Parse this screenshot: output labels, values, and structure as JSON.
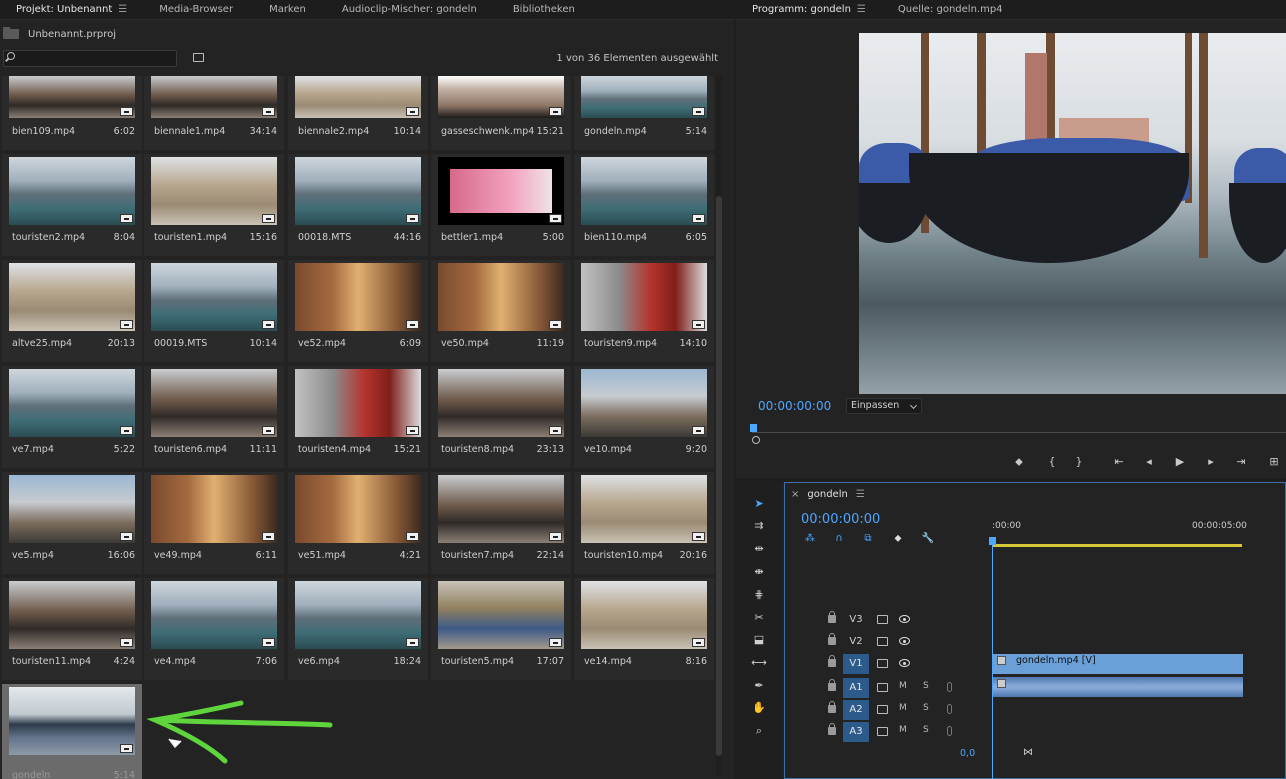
{
  "project_panel": {
    "tabs": [
      {
        "label": "Projekt: Unbenannt",
        "active": true
      },
      {
        "label": "Media-Browser",
        "active": false
      },
      {
        "label": "Marken",
        "active": false
      },
      {
        "label": "Audioclip-Mischer: gondeln",
        "active": false
      },
      {
        "label": "Bibliotheken",
        "active": false
      }
    ],
    "project_file": "Unbenannt.prproj",
    "search_placeholder": "",
    "selection_status": "1 von 36 Elementen ausgewählt",
    "items": [
      {
        "name": "bien109.mp4",
        "duration": "6:02",
        "style": "crowd"
      },
      {
        "name": "biennale1.mp4",
        "duration": "34:14",
        "style": "crowd"
      },
      {
        "name": "biennale2.mp4",
        "duration": "10:14",
        "style": "square"
      },
      {
        "name": "gasseschwenk.mp4",
        "duration": "15:21",
        "style": "wall"
      },
      {
        "name": "gondeln.mp4",
        "duration": "5:14",
        "style": "canal"
      },
      {
        "name": "touristen2.mp4",
        "duration": "8:04",
        "style": "canal"
      },
      {
        "name": "touristen1.mp4",
        "duration": "15:16",
        "style": "square"
      },
      {
        "name": "00018.MTS",
        "duration": "44:16",
        "style": "canal"
      },
      {
        "name": "bettler1.mp4",
        "duration": "5:00",
        "style": "pink"
      },
      {
        "name": "bien110.mp4",
        "duration": "6:05",
        "style": "canal"
      },
      {
        "name": "altve25.mp4",
        "duration": "20:13",
        "style": "square"
      },
      {
        "name": "00019.MTS",
        "duration": "10:14",
        "style": "canal"
      },
      {
        "name": "ve52.mp4",
        "duration": "6:09",
        "style": "street"
      },
      {
        "name": "ve50.mp4",
        "duration": "11:19",
        "style": "street"
      },
      {
        "name": "touristen9.mp4",
        "duration": "14:10",
        "style": "red"
      },
      {
        "name": "ve7.mp4",
        "duration": "5:22",
        "style": "canal"
      },
      {
        "name": "touristen6.mp4",
        "duration": "11:11",
        "style": "crowd"
      },
      {
        "name": "touristen4.mp4",
        "duration": "15:21",
        "style": "red"
      },
      {
        "name": "touristen8.mp4",
        "duration": "23:13",
        "style": "crowd"
      },
      {
        "name": "ve10.mp4",
        "duration": "9:20",
        "style": "blue"
      },
      {
        "name": "ve5.mp4",
        "duration": "16:06",
        "style": "blue"
      },
      {
        "name": "ve49.mp4",
        "duration": "6:11",
        "style": "street"
      },
      {
        "name": "ve51.mp4",
        "duration": "4:21",
        "style": "street"
      },
      {
        "name": "touristen7.mp4",
        "duration": "22:14",
        "style": "crowd"
      },
      {
        "name": "touristen10.mp4",
        "duration": "20:16",
        "style": "square"
      },
      {
        "name": "touristen11.mp4",
        "duration": "4:24",
        "style": "crowd"
      },
      {
        "name": "ve4.mp4",
        "duration": "7:06",
        "style": "canal"
      },
      {
        "name": "ve6.mp4",
        "duration": "18:24",
        "style": "canal"
      },
      {
        "name": "touristen5.mp4",
        "duration": "17:07",
        "style": "market"
      },
      {
        "name": "ve14.mp4",
        "duration": "8:16",
        "style": "square"
      },
      {
        "name": "gondeln",
        "duration": "5:14",
        "style": "gondola",
        "selected": true
      }
    ]
  },
  "program_monitor": {
    "tabs": [
      {
        "label": "Programm: gondeln",
        "active": true
      },
      {
        "label": "Quelle: gondeln.mp4",
        "active": false
      }
    ],
    "timecode": "00:00:00:00",
    "fit_label": "Einpassen"
  },
  "timeline": {
    "sequence_name": "gondeln",
    "timecode": "00:00:00:00",
    "ruler_labels": [
      ":00:00",
      "00:00:05:00"
    ],
    "tracks": [
      {
        "name": "V3",
        "type": "video"
      },
      {
        "name": "V2",
        "type": "video"
      },
      {
        "name": "V1",
        "type": "video",
        "target": true,
        "clip": "gondeln.mp4 [V]"
      },
      {
        "name": "A1",
        "type": "audio",
        "target": true,
        "clip": "audio"
      },
      {
        "name": "A2",
        "type": "audio",
        "target": true
      },
      {
        "name": "A3",
        "type": "audio",
        "target": true
      }
    ],
    "audio_level": "0,0",
    "mute_label": "M",
    "solo_label": "S"
  }
}
